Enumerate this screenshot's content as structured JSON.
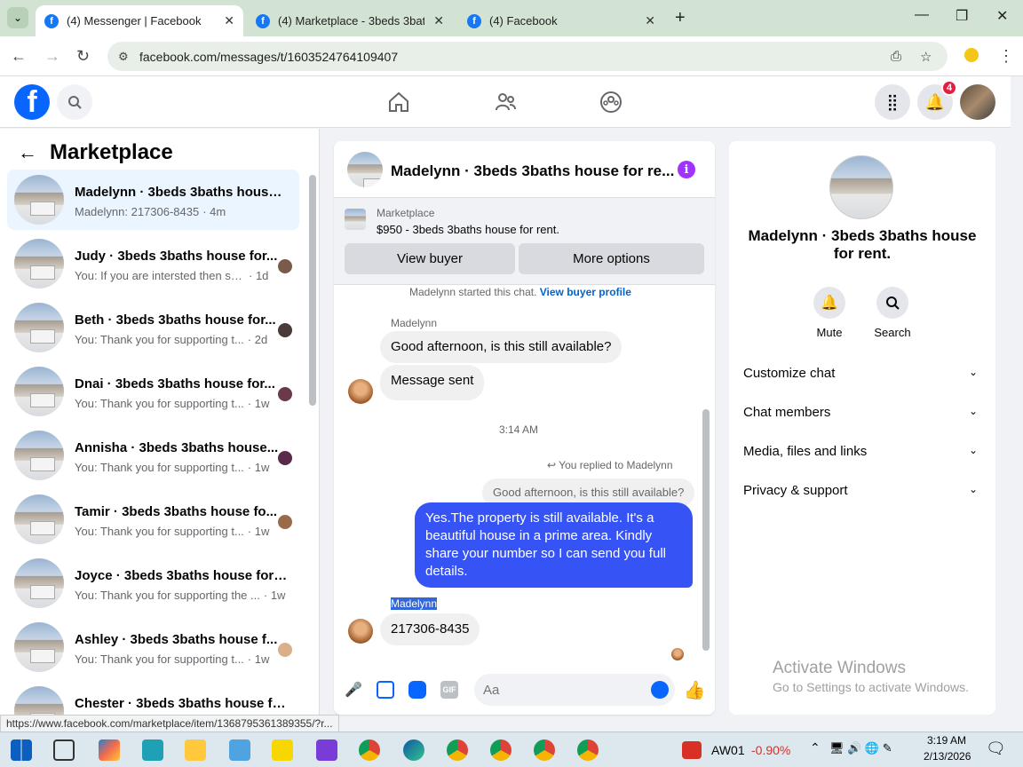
{
  "browser": {
    "tabs": [
      {
        "title": "(4) Messenger | Facebook"
      },
      {
        "title": "(4) Marketplace - 3beds 3baths"
      },
      {
        "title": "(4) Facebook"
      }
    ],
    "url": "facebook.com/messages/t/1603524764109407",
    "status_url": "https://www.facebook.com/marketplace/item/1368795361389355/?r..."
  },
  "fb": {
    "notification_count": "4"
  },
  "left": {
    "title": "Marketplace",
    "conversations": [
      {
        "title": "Madelynn · 3beds 3baths house ...",
        "preview": "Madelynn: 217306-8435",
        "time": "· 4m"
      },
      {
        "title": "Judy · 3beds 3baths house for...",
        "preview": "You: If you are intersted then se...",
        "time": "· 1d"
      },
      {
        "title": "Beth · 3beds 3baths house for...",
        "preview": "You: Thank you for supporting t...",
        "time": "· 2d"
      },
      {
        "title": "Dnai · 3beds 3baths house for...",
        "preview": "You: Thank you for supporting t...",
        "time": "· 1w"
      },
      {
        "title": "Annisha · 3beds 3baths house...",
        "preview": "You: Thank you for supporting t...",
        "time": "· 1w"
      },
      {
        "title": "Tamir · 3beds 3baths house fo...",
        "preview": "You: Thank you for supporting t...",
        "time": "· 1w"
      },
      {
        "title": "Joyce · 3beds 3baths house for r...",
        "preview": "You: Thank you for supporting the ...",
        "time": "· 1w"
      },
      {
        "title": "Ashley · 3beds 3baths house f...",
        "preview": "You: Thank you for supporting t...",
        "time": "· 1w"
      },
      {
        "title": "Chester · 3beds 3baths house fo...",
        "preview": "",
        "time": ""
      }
    ]
  },
  "chat": {
    "title": "Madelynn · 3beds 3baths house for re...",
    "listing_source": "Marketplace",
    "listing_price": "$950 - 3beds 3baths house for rent.",
    "view_buyer": "View buyer",
    "more_options": "More options",
    "started_text": "Madelynn started this chat.",
    "view_buyer_profile": "View buyer profile",
    "sender_name": "Madelynn",
    "msg1": "Good afternoon, is this still available?",
    "msg2": "Message sent",
    "timestamp": "3:14 AM",
    "replied_to": "You replied to Madelynn",
    "quoted": "Good afternoon, is this still available?",
    "reply": "Yes.The property is still available. It's a beautiful house in a prime area. Kindly share your number so I can send you full details.",
    "sender_name2": "Madelynn",
    "msg3": "217306-8435",
    "input_placeholder": "Aa"
  },
  "right": {
    "name": "Madelynn · 3beds 3baths house for rent.",
    "mute": "Mute",
    "search": "Search",
    "rows": [
      "Customize chat",
      "Chat members",
      "Media, files and links",
      "Privacy & support"
    ]
  },
  "watermark": {
    "line1": "Activate Windows",
    "line2": "Go to Settings to activate Windows."
  },
  "taskbar": {
    "ticker": "AW01",
    "change": "-0.90%",
    "time": "3:19 AM",
    "date": "2/13/2026"
  }
}
